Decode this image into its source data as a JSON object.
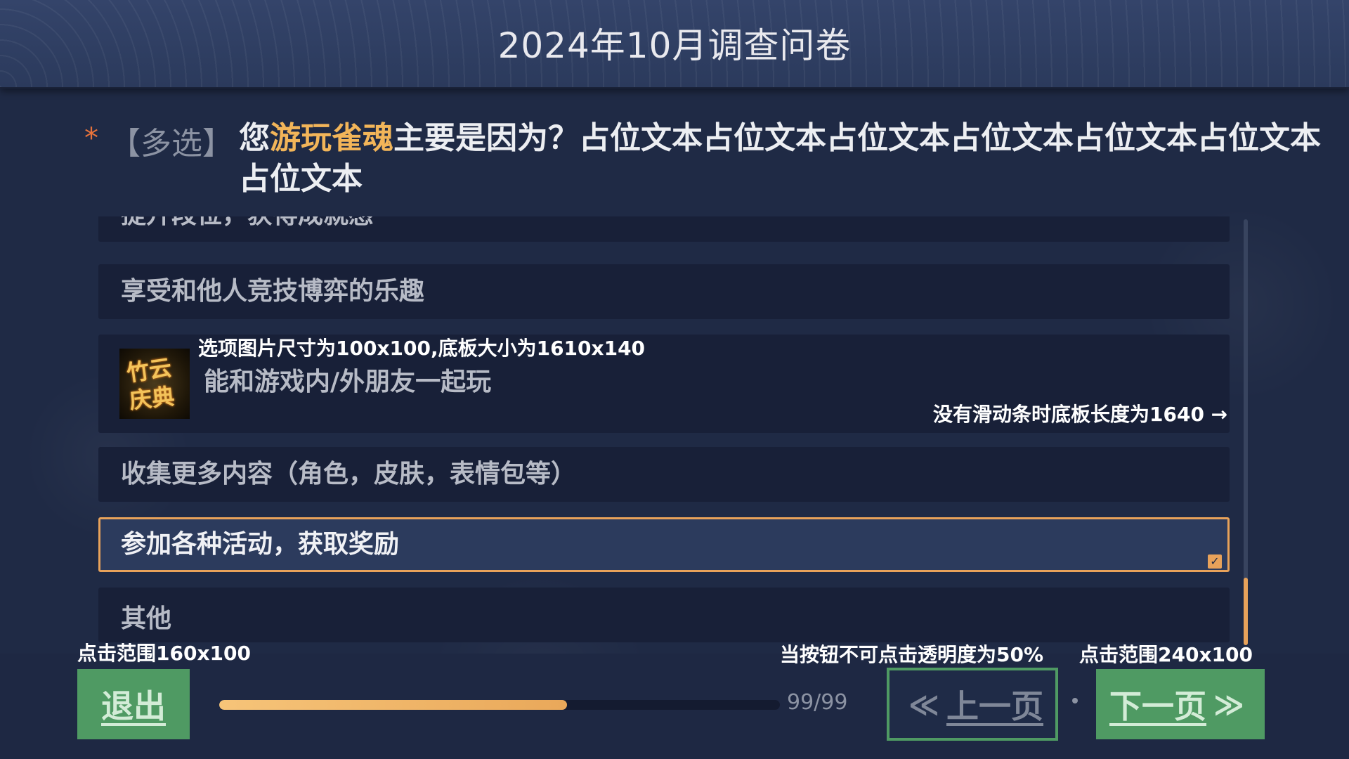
{
  "header": {
    "title": "2024年10月调查问卷"
  },
  "question": {
    "required_mark": "*",
    "type_tag": "【多选】",
    "text_before": "您",
    "highlight": "游玩雀魂",
    "text_after": "主要是因为？占位文本占位文本占位文本占位文本占位文本占位文本占位文本",
    "highlight_color": "#f2b559"
  },
  "options": [
    {
      "label": "提升段位，获得成就感",
      "selected": false
    },
    {
      "label": "享受和他人竞技博弈的乐趣",
      "selected": false
    },
    {
      "label": "能和游戏内/外朋友一起玩",
      "selected": false,
      "image_text_1": "竹云",
      "image_text_2": "庆典"
    },
    {
      "label": "收集更多内容（角色，皮肤，表情包等）",
      "selected": false
    },
    {
      "label": "参加各种活动，获取奖励",
      "selected": true
    },
    {
      "label": "其他",
      "selected": false
    }
  ],
  "annotations": {
    "option_image": "选项图片尺寸为100x100,底板大小为1610x140",
    "no_scrollbar": "没有滑动条时底板长度为1640 →",
    "exit_hit": "点击范围160x100",
    "disabled_opacity": "当按钮不可点击透明度为50%",
    "nav_hit": "点击范围240x100"
  },
  "footer": {
    "exit_label": "退出",
    "prev_label": "上一页",
    "next_label": "下一页",
    "prev_chevron": "≪",
    "next_chevron": "≫",
    "progress_text": "99/99",
    "progress_fraction": 0.62
  },
  "colors": {
    "accent": "#e8a25a",
    "button_green": "#4f9a63",
    "background": "#1f2a45",
    "required": "#e8733b"
  }
}
